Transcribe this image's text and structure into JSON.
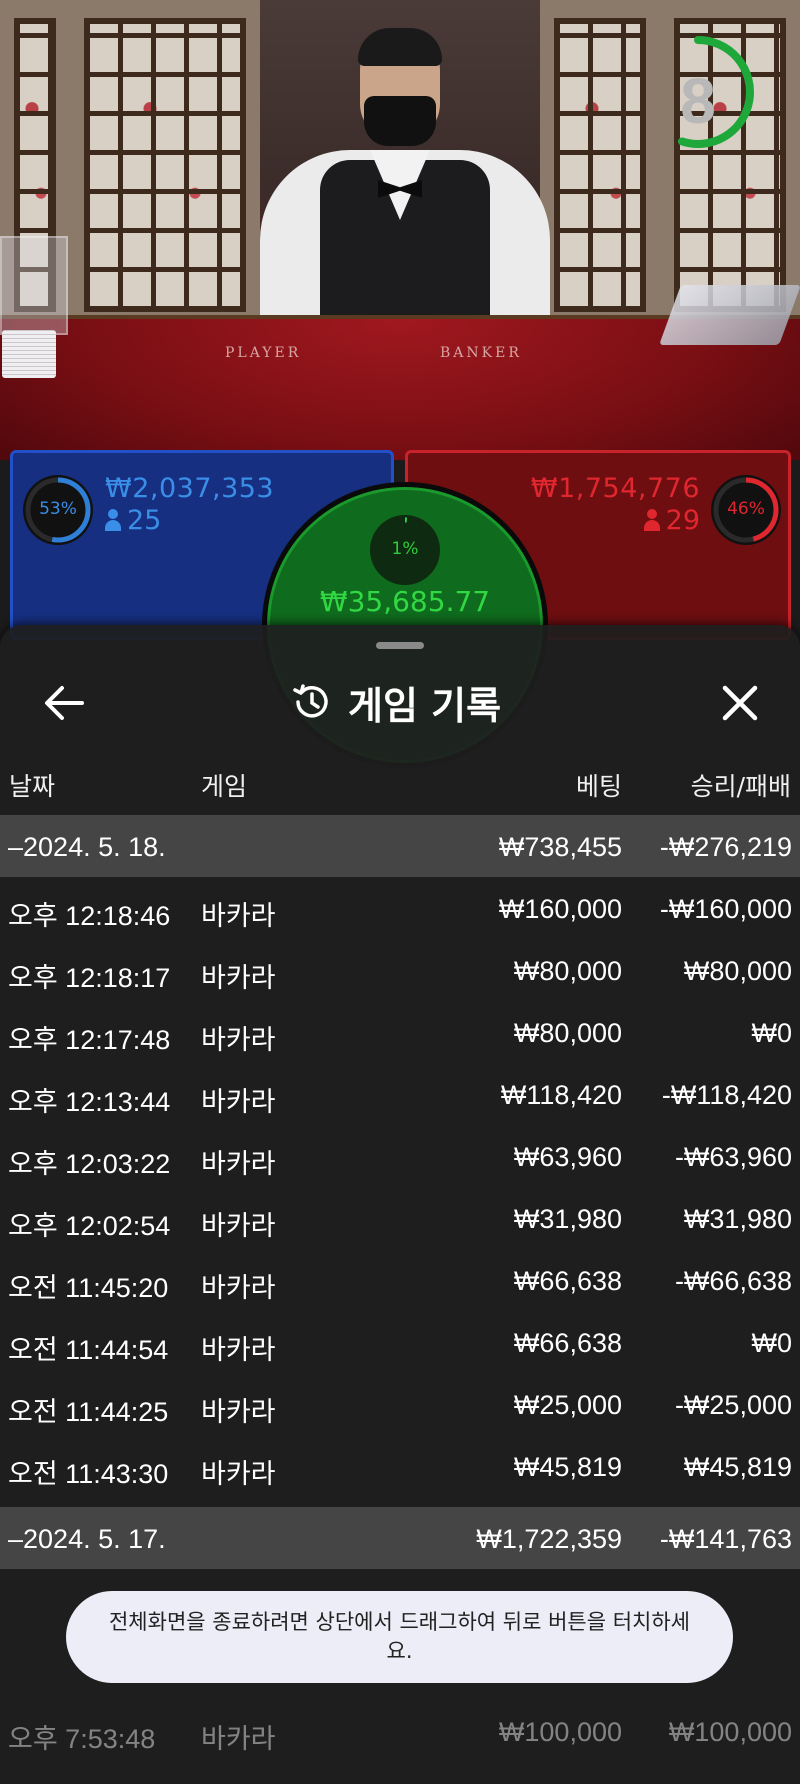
{
  "video": {
    "countdown": "8",
    "countdown_fraction": 0.55,
    "table_labels": {
      "player": "PLAYER",
      "banker": "BANKER"
    }
  },
  "bets": {
    "player": {
      "percent": "53%",
      "percent_value": 0.53,
      "amount": "₩2,037,353",
      "players": "25",
      "color": "#2f7fd8"
    },
    "banker": {
      "percent": "46%",
      "percent_value": 0.46,
      "amount": "₩1,754,776",
      "players": "29",
      "color": "#e0262e"
    },
    "tie": {
      "percent": "1%",
      "percent_value": 0.01,
      "amount": "₩35,685.77",
      "color": "#31d844"
    }
  },
  "sheet": {
    "title": "게임 기록",
    "icons": {
      "back": "arrow-left-icon",
      "history": "history-icon",
      "close": "close-icon"
    },
    "headers": {
      "date": "날짜",
      "game": "게임",
      "bet": "베팅",
      "result": "승리/패배"
    },
    "groups": [
      {
        "date": "–2024. 5. 18.",
        "total_bet": "₩738,455",
        "total_result": "-₩276,219",
        "rows": [
          {
            "time": "오후 12:18:46",
            "game": "바카라",
            "bet": "₩160,000",
            "result": "-₩160,000"
          },
          {
            "time": "오후 12:18:17",
            "game": "바카라",
            "bet": "₩80,000",
            "result": "₩80,000"
          },
          {
            "time": "오후 12:17:48",
            "game": "바카라",
            "bet": "₩80,000",
            "result": "₩0"
          },
          {
            "time": "오후 12:13:44",
            "game": "바카라",
            "bet": "₩118,420",
            "result": "-₩118,420"
          },
          {
            "time": "오후 12:03:22",
            "game": "바카라",
            "bet": "₩63,960",
            "result": "-₩63,960"
          },
          {
            "time": "오후 12:02:54",
            "game": "바카라",
            "bet": "₩31,980",
            "result": "₩31,980"
          },
          {
            "time": "오전 11:45:20",
            "game": "바카라",
            "bet": "₩66,638",
            "result": "-₩66,638"
          },
          {
            "time": "오전 11:44:54",
            "game": "바카라",
            "bet": "₩66,638",
            "result": "₩0"
          },
          {
            "time": "오전 11:44:25",
            "game": "바카라",
            "bet": "₩25,000",
            "result": "-₩25,000"
          },
          {
            "time": "오전 11:43:30",
            "game": "바카라",
            "bet": "₩45,819",
            "result": "₩45,819"
          }
        ]
      },
      {
        "date": "–2024. 5. 17.",
        "total_bet": "₩1,722,359",
        "total_result": "-₩141,763",
        "rows": [
          {
            "time": "오후 7:53:48",
            "game": "바카라",
            "bet": "₩100,000",
            "result": "₩100,000"
          }
        ]
      }
    ]
  },
  "toast": {
    "message": "전체화면을 종료하려면 상단에서 드래그하여 뒤로 버튼을 터치하세요."
  }
}
